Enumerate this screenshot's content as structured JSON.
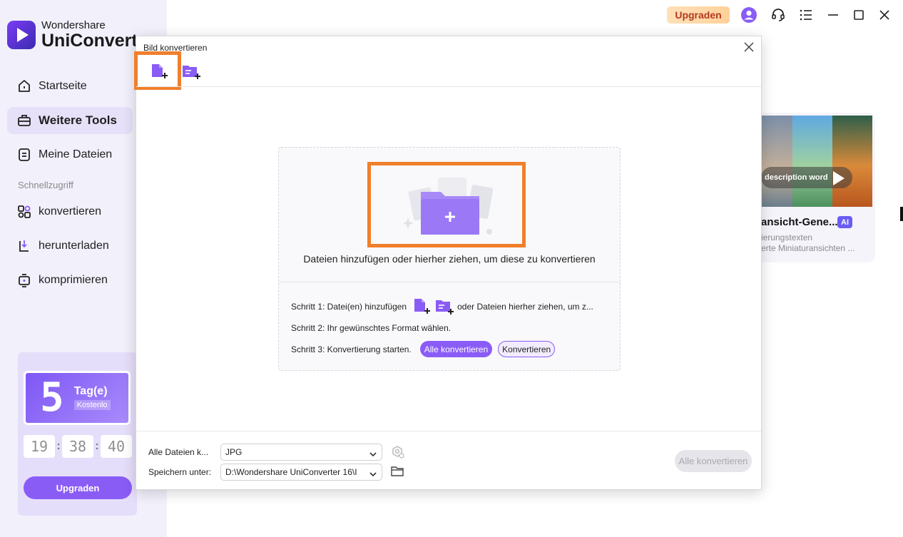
{
  "app": {
    "brand_small": "Wondershare",
    "brand_big": "UniConverter",
    "accent": "#8a5cf6"
  },
  "sidebar": {
    "items": [
      {
        "label": "Startseite",
        "icon": "home-icon"
      },
      {
        "label": "Weitere Tools",
        "icon": "toolbox-icon",
        "active": true
      },
      {
        "label": "Meine Dateien",
        "icon": "files-icon"
      }
    ],
    "quick_label": "Schnellzugriff",
    "quick_items": [
      {
        "label": "konvertieren",
        "icon": "convert-icon"
      },
      {
        "label": "herunterladen",
        "icon": "download-icon"
      },
      {
        "label": "komprimieren",
        "icon": "compress-icon"
      }
    ]
  },
  "promo": {
    "big_digit": "5",
    "days_label": "Tag(e)",
    "free_label": "Kostenlo",
    "timer": [
      "19",
      "38",
      "40"
    ],
    "upgrade_label": "Upgraden"
  },
  "topbar": {
    "upgrade_label": "Upgraden"
  },
  "background_card": {
    "pill_text": "description word",
    "title": "ansicht-Gene...",
    "badge": "AI",
    "sub1": "ierungstexten",
    "sub2": "erte Miniaturansichten ..."
  },
  "dialog": {
    "title": "Bild konvertieren",
    "drop_text": "Dateien hinzufügen oder hierher ziehen, um diese zu konvertieren",
    "step1_label": "Schritt 1: Datei(en) hinzufügen",
    "step1_suffix": "oder Dateien hierher ziehen, um z...",
    "step2_label": "Schritt 2: Ihr gewünschtes Format wählen.",
    "step3_label": "Schritt 3: Konvertierung starten.",
    "convert_all_pill": "Alle konvertieren",
    "convert_pill": "Konvertieren",
    "all_files_label": "Alle Dateien k...",
    "format_value": "JPG",
    "save_label": "Speichern unter:",
    "save_path": "D:\\Wondershare UniConverter 16\\I",
    "convert_all_button": "Alle konvertieren"
  }
}
